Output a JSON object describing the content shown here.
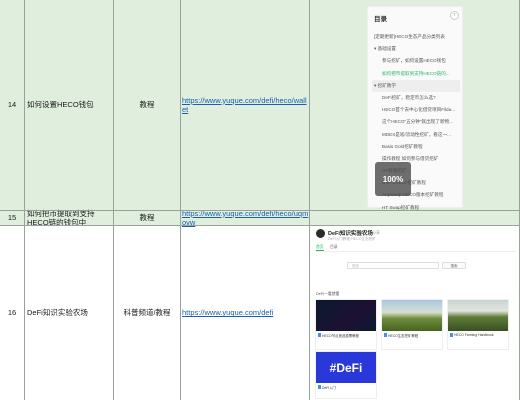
{
  "rows": [
    {
      "num": "14",
      "title": "如何设置HECO钱包",
      "category": "教程",
      "url": "https://www.yuque.com/defi/heco/wallet"
    },
    {
      "num": "15",
      "title": "如何把币提取到支持HECO链的钱包中",
      "category": "教程",
      "url": "https://www.yuque.com/defi/heco/uqmovw"
    },
    {
      "num": "16",
      "title": "DeFi知识实验农场",
      "category": "科普频道/教程",
      "url": "https://www.yuque.com/defi"
    }
  ],
  "toc": {
    "heading": "目录",
    "collapse_icon": "chevron-left-icon",
    "items": [
      "[定期更新]HECO生态产品分类列表",
      "基础设置",
      "参与挖矿，如何设置HECO钱包",
      "如何把币提取到支持HECO链的...",
      "挖矿教学",
      "DeFi挖矿，稳定币怎么选?",
      "HECO首个去中心化借贷项目Filda...",
      "这个HECO\"五分钟\"就出现了新物...",
      "MDEX是啥/流动性挖矿，看这一...",
      "Basis Gold挖矿教程",
      "操作教程 如何参与借贷挖矿",
      "HT新版挖矿...",
      "BXH.finance挖矿教程",
      "AnySwap HECO版本挖矿教程",
      "HT Swap挖矿教程"
    ],
    "zoom_label": "100%"
  },
  "kb": {
    "name": "DeFi知识实验农场",
    "share": "分享",
    "sub": "DeFi入门教程·HECO生态挖矿",
    "tabs": [
      "首页",
      "目录"
    ],
    "search_placeholder": "搜索",
    "search_button": "搜索",
    "section_title": "DeFi一看就懂",
    "cards": [
      {
        "caption": "HECO节点竞选投票教程",
        "meta": "...",
        "image": "dark-network"
      },
      {
        "caption": "HECO生态挖矿教程",
        "meta": "...",
        "image": "farm-field"
      },
      {
        "caption": "HECO Farming Handbook",
        "meta": "...",
        "image": "farm-road"
      },
      {
        "caption": "DeFi入门",
        "meta": "...",
        "image": "defi-logo",
        "logo_text": "#DeFi"
      }
    ]
  },
  "colors": {
    "row_green": "#dfeedd",
    "link": "#1a5fb4",
    "accent": "#25b864",
    "defi_blue": "#2b38d9"
  }
}
